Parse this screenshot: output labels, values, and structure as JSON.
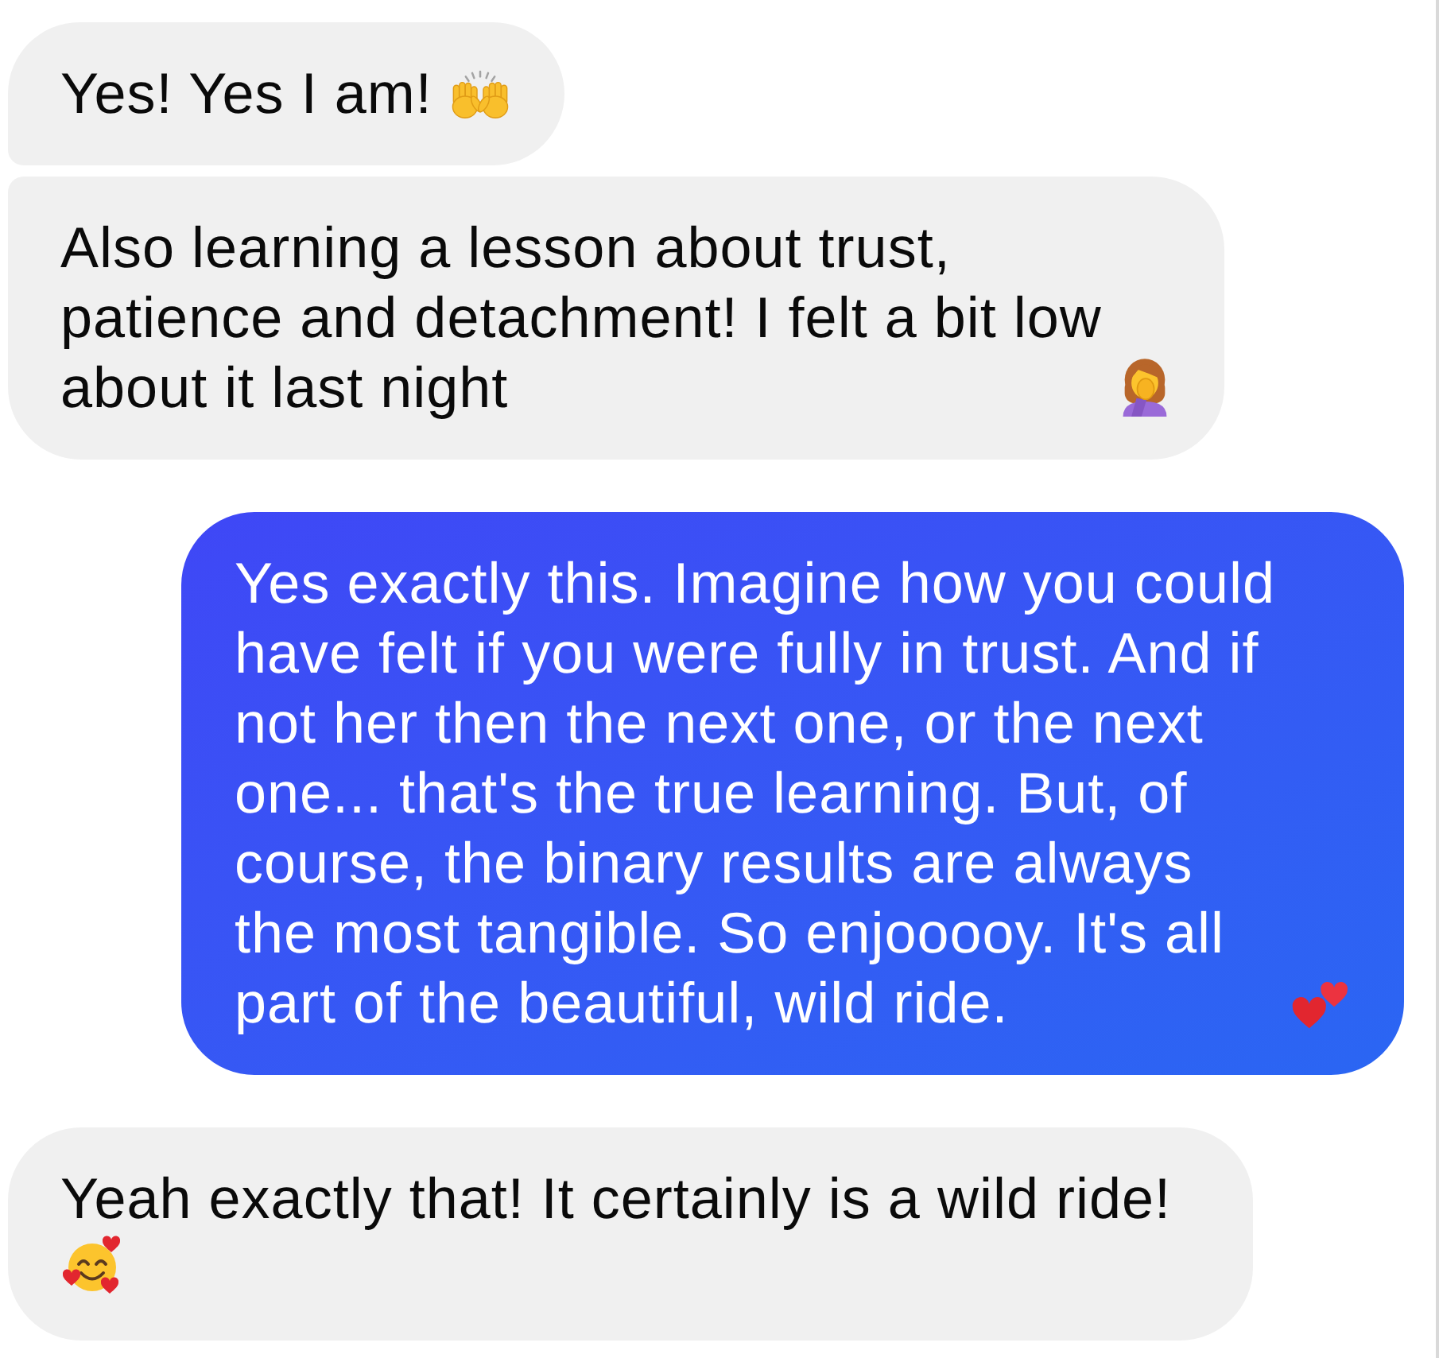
{
  "messages": [
    {
      "kind": "received",
      "text": "Yes! Yes I am!"
    },
    {
      "kind": "received",
      "text": "Also learning a lesson about trust,\npatience and detachment! I felt a bit low\nabout it last night"
    },
    {
      "kind": "sent",
      "text": "Yes exactly this. Imagine how you could\nhave felt if you were fully in trust. And if\nnot her then the next one, or the next\none... that's the true learning. But, of\ncourse, the binary results are always\nthe most tangible. So enjooooy. It's all\npart of the beautiful, wild ride."
    },
    {
      "kind": "received",
      "text": "Yeah exactly that! It certainly is a wild ride!"
    }
  ]
}
